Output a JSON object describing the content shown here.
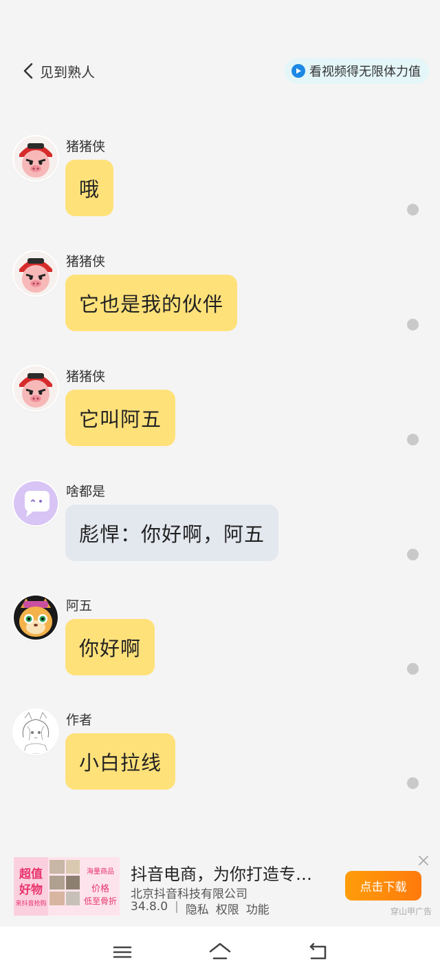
{
  "header": {
    "back_label": "见到熟人",
    "energy_label": "看视频得无限体力值"
  },
  "messages": [
    {
      "sender": "猪猪侠",
      "text": "哦",
      "style": "yellow",
      "avatar": "pig-hero-avatar"
    },
    {
      "sender": "猪猪侠",
      "text": "它也是我的伙伴",
      "style": "yellow",
      "avatar": "pig-hero-avatar"
    },
    {
      "sender": "猪猪侠",
      "text": "它叫阿五",
      "style": "yellow",
      "avatar": "pig-hero-avatar"
    },
    {
      "sender": "啥都是",
      "text": "彪悍：你好啊，阿五",
      "style": "gray",
      "avatar": "chat-bubble-avatar"
    },
    {
      "sender": "阿五",
      "text": "你好啊",
      "style": "yellow",
      "avatar": "cartoon-cat-avatar"
    },
    {
      "sender": "作者",
      "text": "小白拉线",
      "style": "yellow",
      "avatar": "sketch-girl-avatar"
    }
  ],
  "ad": {
    "image_text_1": "超值",
    "image_text_2": "好物",
    "image_text_3": "来抖音抢购",
    "image_text_4": "海量商品",
    "image_text_5": "价格",
    "image_text_6": "低至骨折",
    "title": "抖音电商，为你打造专…",
    "company": "北京抖音科技有限公司",
    "version": "34.8.0",
    "links": [
      "隐私",
      "权限",
      "功能"
    ],
    "download_label": "点击下载",
    "source_label": "穿山甲广告"
  },
  "colors": {
    "bubble_yellow": "#ffe17a",
    "bubble_gray": "#e3e7ee",
    "download_orange": "#ff8c0a"
  },
  "navbar": {
    "icons": [
      "menu-icon",
      "home-icon",
      "back-icon"
    ]
  }
}
